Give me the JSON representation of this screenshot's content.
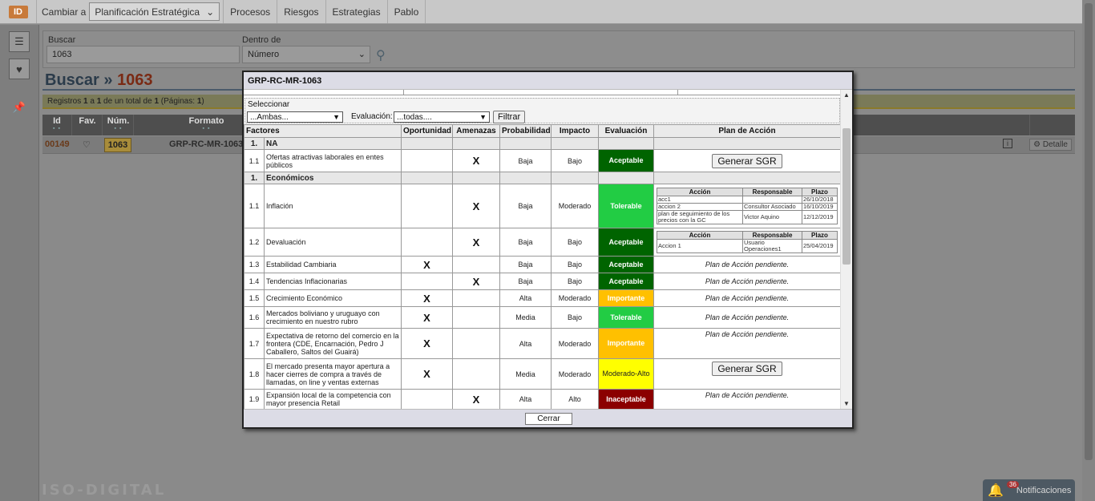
{
  "topbar": {
    "change_label": "Cambiar a",
    "module": "Planificación Estratégica",
    "tabs": [
      "Procesos",
      "Riesgos",
      "Estrategias",
      "Pablo"
    ]
  },
  "search": {
    "label": "Buscar",
    "value": "1063",
    "within_label": "Dentro de",
    "within_value": "Número"
  },
  "heading": {
    "prefix": "Buscar » ",
    "number": "1063"
  },
  "records": {
    "text_a": "Registros ",
    "from": "1",
    "text_b": " a ",
    "to": "1",
    "text_c": " de un total de ",
    "total": "1",
    "text_d": " (Páginas: ",
    "pages": "1",
    "text_e": ")"
  },
  "grid": {
    "headers": {
      "id": "Id",
      "fav": "Fav.",
      "num": "Núm.",
      "formato": "Formato"
    },
    "row": {
      "id": "00149",
      "num": "1063",
      "formato": "GRP-RC-MR-1063",
      "detail": "Detalle"
    }
  },
  "footer": {
    "brand": "ISO-DIGITAL",
    "notifications_label": "Notificaciones",
    "notifications_count": "36"
  },
  "modal": {
    "title": "GRP-RC-MR-1063",
    "filter": {
      "select_label": "Seleccionar",
      "select_value": "...Ambas...",
      "eval_label": "Evaluación:",
      "eval_value": "...todas....",
      "filter_button": "Filtrar"
    },
    "columns": [
      "Factores",
      "Oportunidad",
      "Amenazas",
      "Probabilidad",
      "Impacto",
      "Evaluación",
      "Plan de Acción"
    ],
    "plan_columns": [
      "Acción",
      "Responsable",
      "Plazo"
    ],
    "generate_label": "Generar SGR",
    "pending_label": "Plan de Acción pendiente.",
    "mark": "X",
    "sections": [
      {
        "num": "1.",
        "name": "NA"
      },
      {
        "num": "1.",
        "name": "Económicos"
      }
    ],
    "rows": [
      {
        "num": "1.1",
        "factor": "Ofertas atractivas laborales en entes públicos",
        "probabilidad": "Baja",
        "impacto": "Bajo",
        "evaluacion": "Aceptable"
      },
      {
        "num": "1.1",
        "factor": "Inflación",
        "probabilidad": "Baja",
        "impacto": "Moderado",
        "evaluacion": "Tolerable",
        "plan": [
          {
            "accion": "acc1",
            "responsable": "",
            "plazo": "26/10/2018"
          },
          {
            "accion": "accion 2",
            "responsable": "Consultor Asociado",
            "plazo": "16/10/2019"
          },
          {
            "accion": "plan de seguimiento de los precios con la GC",
            "responsable": "Victor Aquino",
            "plazo": "12/12/2019"
          }
        ]
      },
      {
        "num": "1.2",
        "factor": "Devaluación",
        "probabilidad": "Baja",
        "impacto": "Bajo",
        "evaluacion": "Aceptable",
        "plan": [
          {
            "accion": "Accion 1",
            "responsable": "Usuario Operaciones1",
            "plazo": "25/04/2019"
          }
        ]
      },
      {
        "num": "1.3",
        "factor": "Estabilidad Cambiaria",
        "probabilidad": "Baja",
        "impacto": "Bajo",
        "evaluacion": "Aceptable"
      },
      {
        "num": "1.4",
        "factor": "Tendencias Inflacionarias",
        "probabilidad": "Baja",
        "impacto": "Bajo",
        "evaluacion": "Aceptable"
      },
      {
        "num": "1.5",
        "factor": "Crecimiento Económico",
        "probabilidad": "Alta",
        "impacto": "Moderado",
        "evaluacion": "Importante"
      },
      {
        "num": "1.6",
        "factor": "Mercados boliviano y uruguayo con crecimiento en nuestro rubro",
        "probabilidad": "Media",
        "impacto": "Bajo",
        "evaluacion": "Tolerable"
      },
      {
        "num": "1.7",
        "factor": "Expectativa de retorno del comercio en la frontera (CDE, Encarnación, Pedro J Caballero, Saltos del Guairá)",
        "probabilidad": "Alta",
        "impacto": "Moderado",
        "evaluacion": "Importante"
      },
      {
        "num": "1.8",
        "factor": "El mercado presenta mayor apertura a hacer cierres de compra a través de llamadas, on line y ventas externas",
        "probabilidad": "Media",
        "impacto": "Moderado",
        "evaluacion": "Moderado-Alto"
      },
      {
        "num": "1.9",
        "factor": "Expansión local de la competencia con mayor presencia Retail",
        "probabilidad": "Alta",
        "impacto": "Alto",
        "evaluacion": "Inaceptable"
      }
    ],
    "colors": {
      "Aceptable": "#006400",
      "Tolerable": "#22cc44",
      "Importante": "#ffc000",
      "Moderado-Alto": "#ffff00",
      "Inaceptable": "#8b0000"
    },
    "close_label": "Cerrar"
  }
}
